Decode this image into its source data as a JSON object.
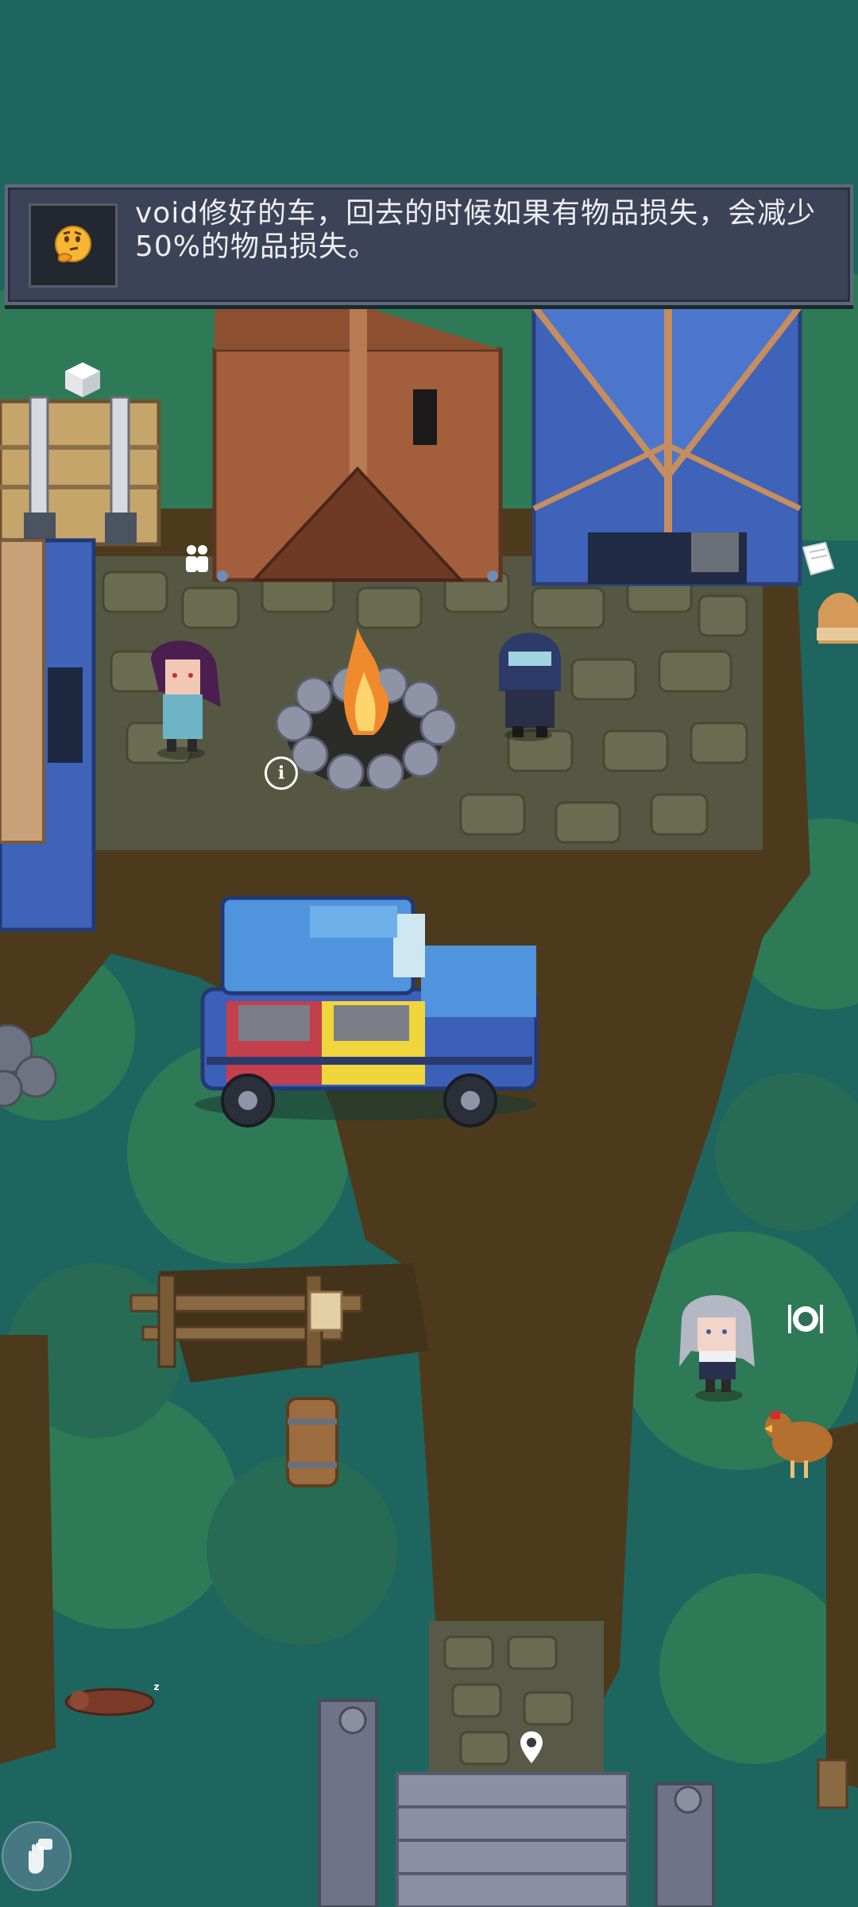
{
  "dialogue": {
    "icon": "thinking-face-icon",
    "text": "void修好的车，回去的时候如果有物品损失，会减少50%的物品损失。"
  },
  "indicators": [
    {
      "name": "storage-cube-icon",
      "icon": "cube"
    },
    {
      "name": "npc-people-icon",
      "icon": "people"
    },
    {
      "name": "book-icon",
      "icon": "book"
    },
    {
      "name": "info-icon",
      "icon": "info"
    },
    {
      "name": "food-plate-icon",
      "icon": "plate"
    },
    {
      "name": "map-pin-icon",
      "icon": "pin"
    },
    {
      "name": "sleep-icon",
      "icon": "zzz"
    }
  ],
  "controls": {
    "corner_button_icon": "gesture-lock-icon"
  },
  "colors": {
    "ground": "#1f655f",
    "dirt": "#4d3a1c",
    "panel": "#3c4356",
    "panel_text": "#eceef2"
  }
}
